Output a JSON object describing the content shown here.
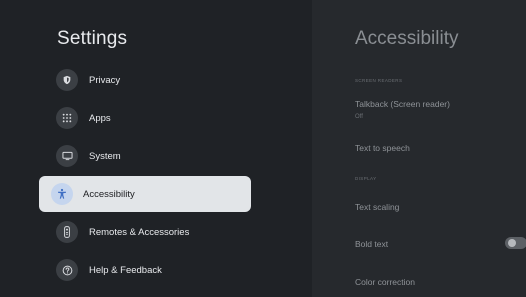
{
  "left": {
    "title": "Settings",
    "items": [
      {
        "label": "Privacy",
        "icon": "shield-icon"
      },
      {
        "label": "Apps",
        "icon": "apps-grid-icon"
      },
      {
        "label": "System",
        "icon": "monitor-icon"
      },
      {
        "label": "Accessibility",
        "icon": "accessibility-icon",
        "selected": true
      },
      {
        "label": "Remotes & Accessories",
        "icon": "remote-icon"
      },
      {
        "label": "Help & Feedback",
        "icon": "help-icon"
      }
    ]
  },
  "right": {
    "title": "Accessibility",
    "sections": {
      "screen_readers": "SCREEN READERS",
      "display": "DISPLAY"
    },
    "options": {
      "talkback": {
        "label": "Talkback (Screen reader)",
        "status": "Off"
      },
      "tts": {
        "label": "Text to speech"
      },
      "text_scaling": {
        "label": "Text scaling"
      },
      "bold_text": {
        "label": "Bold text",
        "toggle_on": false
      },
      "color_correction": {
        "label": "Color correction"
      }
    }
  },
  "colors": {
    "background_left": "#1f2226",
    "background_right": "#26292d",
    "selected_bg": "#e2e5e8",
    "selected_icon_bg": "#c5d5ee",
    "accent_icon": "#3f6fc4"
  }
}
